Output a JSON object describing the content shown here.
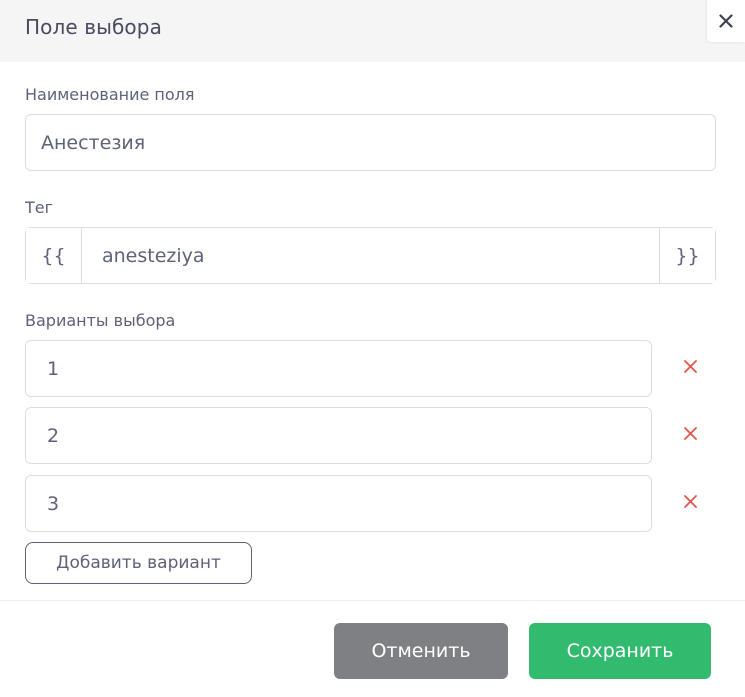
{
  "modal": {
    "title": "Поле выбора"
  },
  "field_name": {
    "label": "Наименование поля",
    "value": "Анестезия"
  },
  "tag": {
    "label": "Тег",
    "prefix": "{{",
    "value": "anesteziya",
    "suffix": "}}"
  },
  "options": {
    "label": "Варианты выбора",
    "items": [
      {
        "value": "1"
      },
      {
        "value": "2"
      },
      {
        "value": "3"
      }
    ],
    "add_label": "Добавить вариант"
  },
  "footer": {
    "cancel_label": "Отменить",
    "save_label": "Сохранить"
  },
  "icons": {
    "close": "close-icon",
    "remove": "remove-icon"
  },
  "colors": {
    "save": "#32bb6e",
    "cancel": "#7e8084",
    "remove": "#e5534b"
  }
}
